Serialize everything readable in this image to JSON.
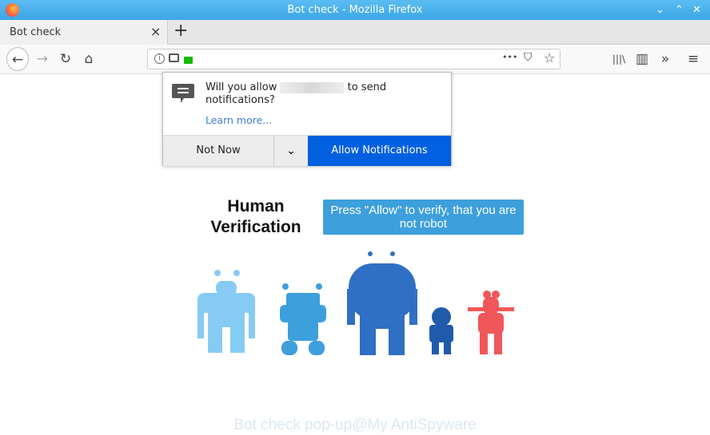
{
  "window": {
    "title": "Bot check - Mozilla Firefox"
  },
  "tab": {
    "label": "Bot check",
    "close": "×",
    "new_tab": "+"
  },
  "nav": {
    "back": "←",
    "forward": "→",
    "reload": "↻",
    "home": "⌂",
    "more": "•••",
    "pocket": "⛉",
    "bookmark": "☆",
    "library": "|||\\",
    "sidebar": "▥",
    "overflow": "»",
    "menu": "≡"
  },
  "popup": {
    "message_before": "Will you allow",
    "message_after": "to send notifications?",
    "learn_more": "Learn more...",
    "not_now": "Not Now",
    "allow": "Allow Notifications",
    "colors": {
      "allow_bg": "#0060df"
    }
  },
  "page": {
    "heading": "Human Verification",
    "button": "Press \"Allow\" to verify, that you are not robot",
    "watermark": "Bot check pop-up@My AntiSpyware",
    "robot_colors": [
      "#86cbf4",
      "#3d9fdc",
      "#2f6fc4",
      "#1f5aab",
      "#f0575a"
    ]
  }
}
